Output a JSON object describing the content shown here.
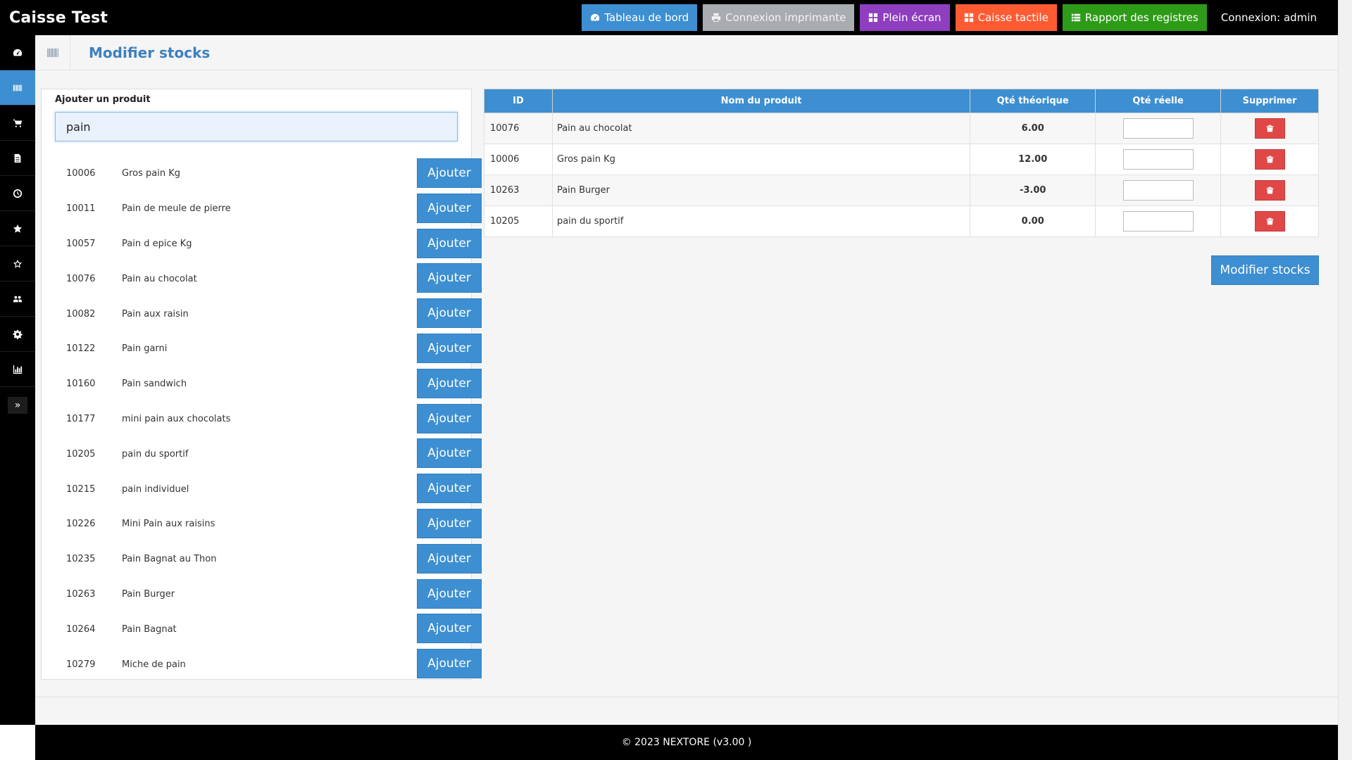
{
  "app": {
    "title": "Caisse Test"
  },
  "topbar": {
    "buttons": [
      {
        "label": "Tableau de bord",
        "icon": "dashboard-icon",
        "color": "#3d8fd1"
      },
      {
        "label": "Connexion imprimante",
        "icon": "printer-icon",
        "color": "#a8acb0"
      },
      {
        "label": "Plein écran",
        "icon": "grid-icon",
        "color": "#8e3ebf"
      },
      {
        "label": "Caisse tactile",
        "icon": "grid-icon",
        "color": "#ff5b33"
      },
      {
        "label": "Rapport des registres",
        "icon": "list-icon",
        "color": "#2e9b18"
      }
    ],
    "login": "Connexion: admin"
  },
  "sidebar": {
    "items": [
      {
        "icon": "dashboard-icon"
      },
      {
        "icon": "barcode-icon",
        "active": true
      },
      {
        "icon": "cart-icon"
      },
      {
        "icon": "document-icon"
      },
      {
        "icon": "clock-icon"
      },
      {
        "icon": "star-icon"
      },
      {
        "icon": "star-outline-icon"
      },
      {
        "icon": "users-icon"
      },
      {
        "icon": "gear-icon"
      },
      {
        "icon": "chart-icon"
      }
    ],
    "toggle": "»"
  },
  "page": {
    "title": "Modifier stocks"
  },
  "add_product": {
    "label": "Ajouter un produit",
    "search_value": "pain",
    "button_label": "Ajouter",
    "results": [
      {
        "id": "10006",
        "name": "Gros pain Kg"
      },
      {
        "id": "10011",
        "name": "Pain de meule de pierre"
      },
      {
        "id": "10057",
        "name": "Pain d epice Kg"
      },
      {
        "id": "10076",
        "name": "Pain au chocolat"
      },
      {
        "id": "10082",
        "name": "Pain aux raisin"
      },
      {
        "id": "10122",
        "name": "Pain garni"
      },
      {
        "id": "10160",
        "name": "Pain sandwich"
      },
      {
        "id": "10177",
        "name": "mini pain aux chocolats"
      },
      {
        "id": "10205",
        "name": "pain du sportif"
      },
      {
        "id": "10215",
        "name": "pain individuel"
      },
      {
        "id": "10226",
        "name": "Mini Pain aux raisins"
      },
      {
        "id": "10235",
        "name": "Pain Bagnat au Thon"
      },
      {
        "id": "10263",
        "name": "Pain Burger"
      },
      {
        "id": "10264",
        "name": "Pain Bagnat"
      },
      {
        "id": "10279",
        "name": "Miche de pain"
      }
    ]
  },
  "stock_table": {
    "columns": [
      "ID",
      "Nom du produit",
      "Qté théorique",
      "Qté réelle",
      "Supprimer"
    ],
    "rows": [
      {
        "id": "10076",
        "name": "Pain au chocolat",
        "qty": "6.00",
        "real": ""
      },
      {
        "id": "10006",
        "name": "Gros pain Kg",
        "qty": "12.00",
        "real": ""
      },
      {
        "id": "10263",
        "name": "Pain Burger",
        "qty": "-3.00",
        "real": ""
      },
      {
        "id": "10205",
        "name": "pain du sportif",
        "qty": "0.00",
        "real": ""
      }
    ]
  },
  "submit": {
    "label": "Modifier stocks"
  },
  "footer": {
    "text": "© 2023 NEXTORE (v3.00 )"
  }
}
